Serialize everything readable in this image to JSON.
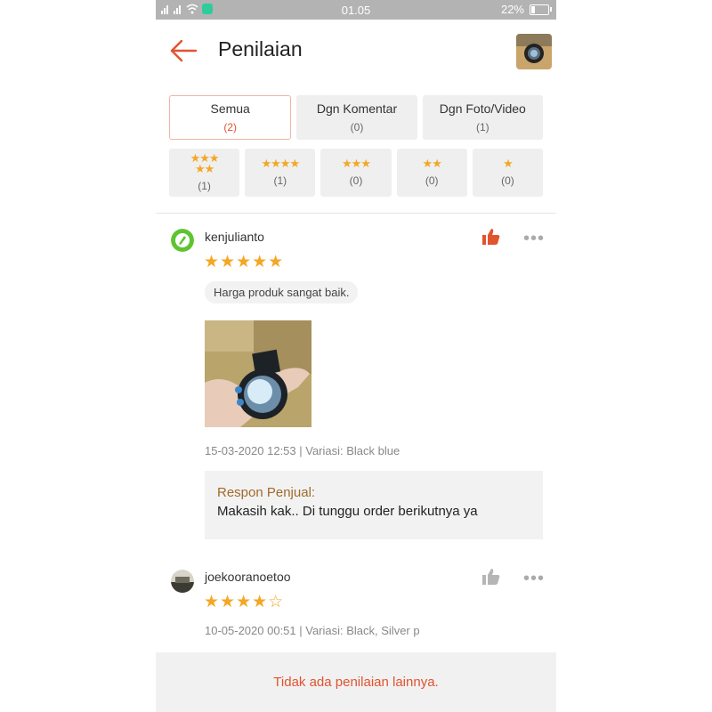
{
  "status_bar": {
    "time": "01.05",
    "battery": "22%"
  },
  "header": {
    "title": "Penilaian",
    "back_icon": "arrow-left-icon",
    "accent": "#e2532e"
  },
  "filters": {
    "tabs": [
      {
        "label": "Semua",
        "count": "(2)",
        "active": true
      },
      {
        "label": "Dgn Komentar",
        "count": "(0)",
        "active": false
      },
      {
        "label": "Dgn Foto/Video",
        "count": "(1)",
        "active": false
      }
    ],
    "star_filters": [
      {
        "stars_top": "★★★",
        "stars_bottom": "★★",
        "count": "(1)"
      },
      {
        "stars_top": "★★★★",
        "count": "(1)"
      },
      {
        "stars_top": "★★★",
        "count": "(0)"
      },
      {
        "stars_top": "★★",
        "count": "(0)"
      },
      {
        "stars_top": "★",
        "count": "(0)"
      }
    ]
  },
  "reviews": [
    {
      "username": "kenjulianto",
      "stars": "★★★★★",
      "rating": 5,
      "comment": "Harga produk sangat baik.",
      "meta": "15-03-2020 12:53 | Variasi: Black blue",
      "liked": true,
      "reply_title": "Respon Penjual:",
      "reply_body": "Makasih kak.. Di tunggu order berikutnya ya"
    },
    {
      "username": "joekooranoetoo",
      "stars": "★★★★☆",
      "rating": 4,
      "meta": "10-05-2020 00:51 | Variasi: Black, Silver p",
      "liked": false
    }
  ],
  "footer": {
    "text": "Tidak ada penilaian lainnya."
  },
  "colors": {
    "star": "#f5a623",
    "accent": "#e2532e",
    "reply_title": "#a06a2c"
  }
}
